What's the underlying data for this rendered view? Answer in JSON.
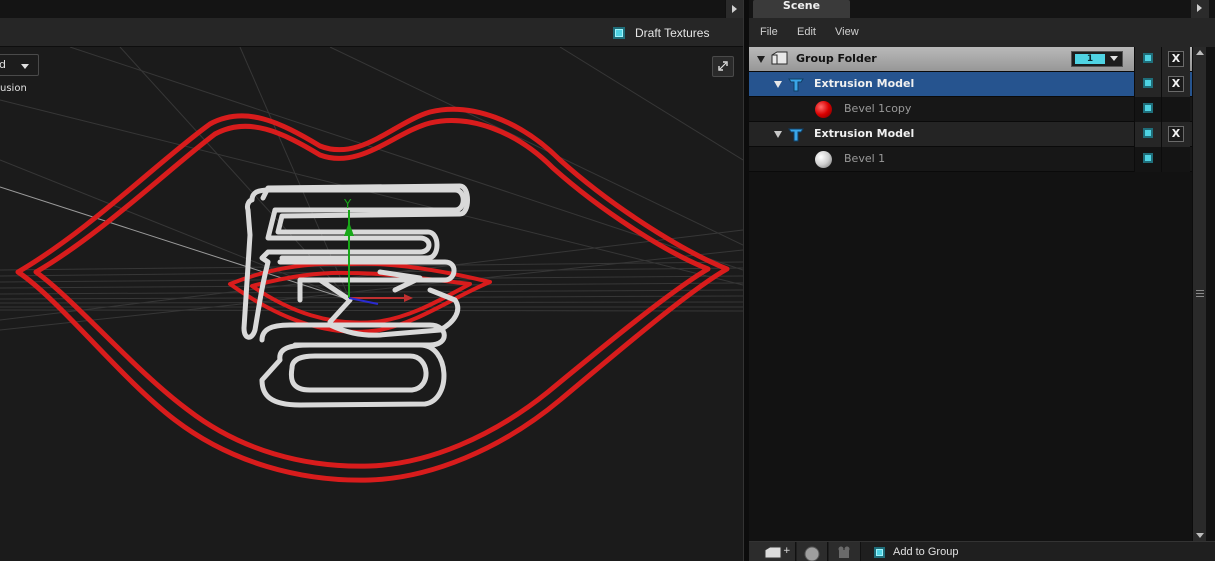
{
  "viewport": {
    "draft_textures_label": "Draft Textures",
    "view_select_value": "d",
    "mode_label": "usion"
  },
  "scene_panel": {
    "tab_label": "Scene",
    "menu": {
      "file": "File",
      "edit": "Edit",
      "view": "View"
    },
    "tree": {
      "group": {
        "label": "Group Folder",
        "count": "1"
      },
      "model1": {
        "label": "Extrusion Model"
      },
      "material1": {
        "label": "Bevel 1copy"
      },
      "model2": {
        "label": "Extrusion Model"
      },
      "material2": {
        "label": "Bevel 1"
      }
    },
    "delete_glyph": "X",
    "add_to_group_label": "Add to Group"
  },
  "colors": {
    "accent_cyan": "#4fd3e3",
    "selection_blue": "#26548f",
    "lips_red": "#d81c1c"
  },
  "icons": [
    "expand-icon",
    "folder-icon",
    "extrusion-model-icon",
    "material-ball-icon",
    "new-folder-icon",
    "sphere-icon",
    "camera-icon"
  ]
}
